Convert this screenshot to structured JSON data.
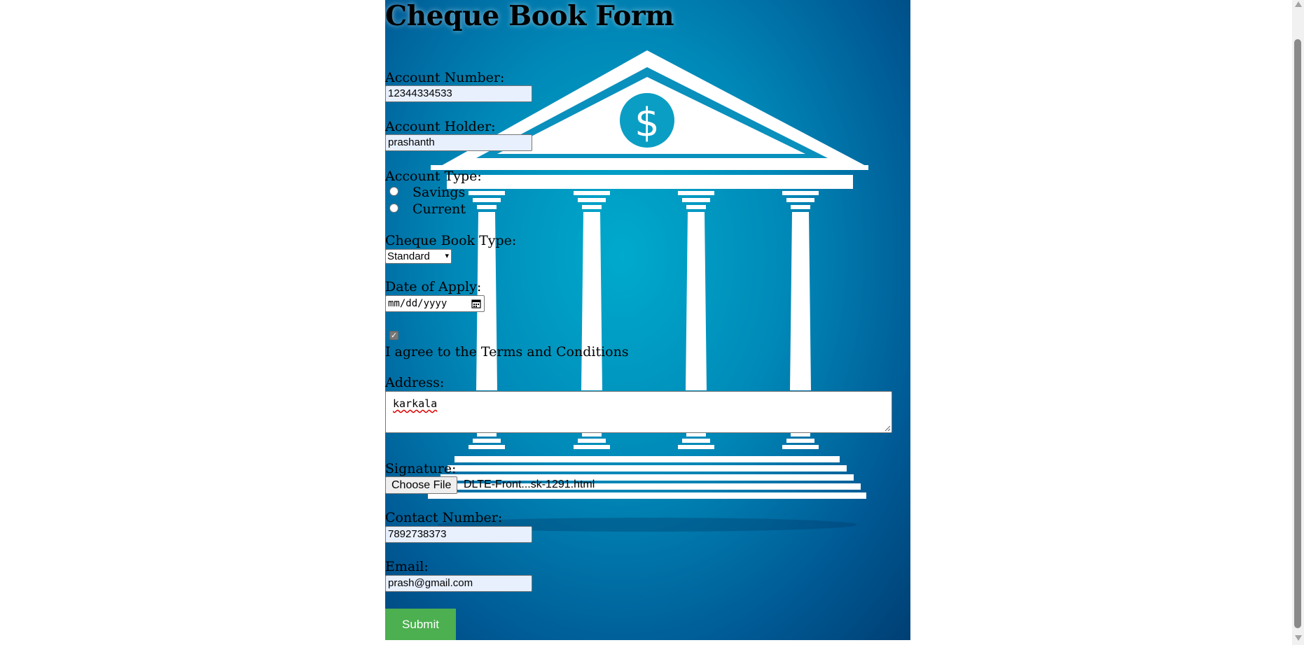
{
  "page": {
    "title": "Cheque Book Form"
  },
  "form": {
    "account_number": {
      "label": "Account Number:",
      "value": "12344334533"
    },
    "account_holder": {
      "label": "Account Holder:",
      "value": "prashanth"
    },
    "account_type": {
      "label": "Account Type:",
      "options": [
        {
          "label": "Savings",
          "checked": false
        },
        {
          "label": "Current",
          "checked": false
        }
      ]
    },
    "cheque_book_type": {
      "label": "Cheque Book Type:",
      "selected": "Standard"
    },
    "date_of_apply": {
      "label": "Date of Apply:",
      "placeholder": "mm/dd/yyyy"
    },
    "terms": {
      "label": "I agree to the Terms and Conditions",
      "checked": true
    },
    "address": {
      "label": "Address:",
      "value": "karkala"
    },
    "signature": {
      "label": "Signature:",
      "button_label": "Choose File",
      "file_name": "DLTE-Front...sk-1291.html"
    },
    "contact_number": {
      "label": "Contact Number:",
      "value": "7892738373"
    },
    "email": {
      "label": "Email:",
      "value": "prash@gmail.com"
    },
    "submit_label": "Submit"
  },
  "hero": {
    "symbol": "$"
  },
  "colors": {
    "accent_submit": "#4caf50",
    "hero_gradient_light": "#00aacc",
    "hero_gradient_dark": "#003f74",
    "autofill_bg": "#e8f0fe"
  }
}
